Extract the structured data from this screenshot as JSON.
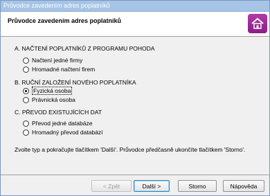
{
  "window": {
    "title": "Průvodce zavedením adres poplatníků"
  },
  "header": {
    "title": "Průvodce zavedením adres poplatníků",
    "logo_icon": "home-icon"
  },
  "sections": [
    {
      "title": "A. NAČTENÍ POPLATNÍKŮ Z PROGRAMU POHODA",
      "options": [
        {
          "label": "Načtení jedné firmy",
          "checked": false
        },
        {
          "label": "Hromadné načtení firem",
          "checked": false
        }
      ]
    },
    {
      "title": "B. RUČNÍ ZALOŽENÍ NOVÉHO POPLATNÍKA",
      "options": [
        {
          "label": "Fyzická osoba",
          "checked": true
        },
        {
          "label": "Právnická osoba",
          "checked": false
        }
      ]
    },
    {
      "title": "C. PŘEVOD EXISTUJÍCÍCH DAT",
      "options": [
        {
          "label": "Převod jedné databáze",
          "checked": false
        },
        {
          "label": "Hromadný převod databází",
          "checked": false
        }
      ]
    }
  ],
  "hint": "Zvolte typ a pokračujte tlačítkem 'Další'. Průvodce předčasně ukončíte tlačítkem 'Storno'.",
  "buttons": {
    "back": "< Zpět",
    "next": "Další >",
    "cancel": "Storno",
    "help": "Nápověda"
  },
  "colors": {
    "title_bar": "#a6c4e6",
    "logo": "#9b2a96"
  }
}
